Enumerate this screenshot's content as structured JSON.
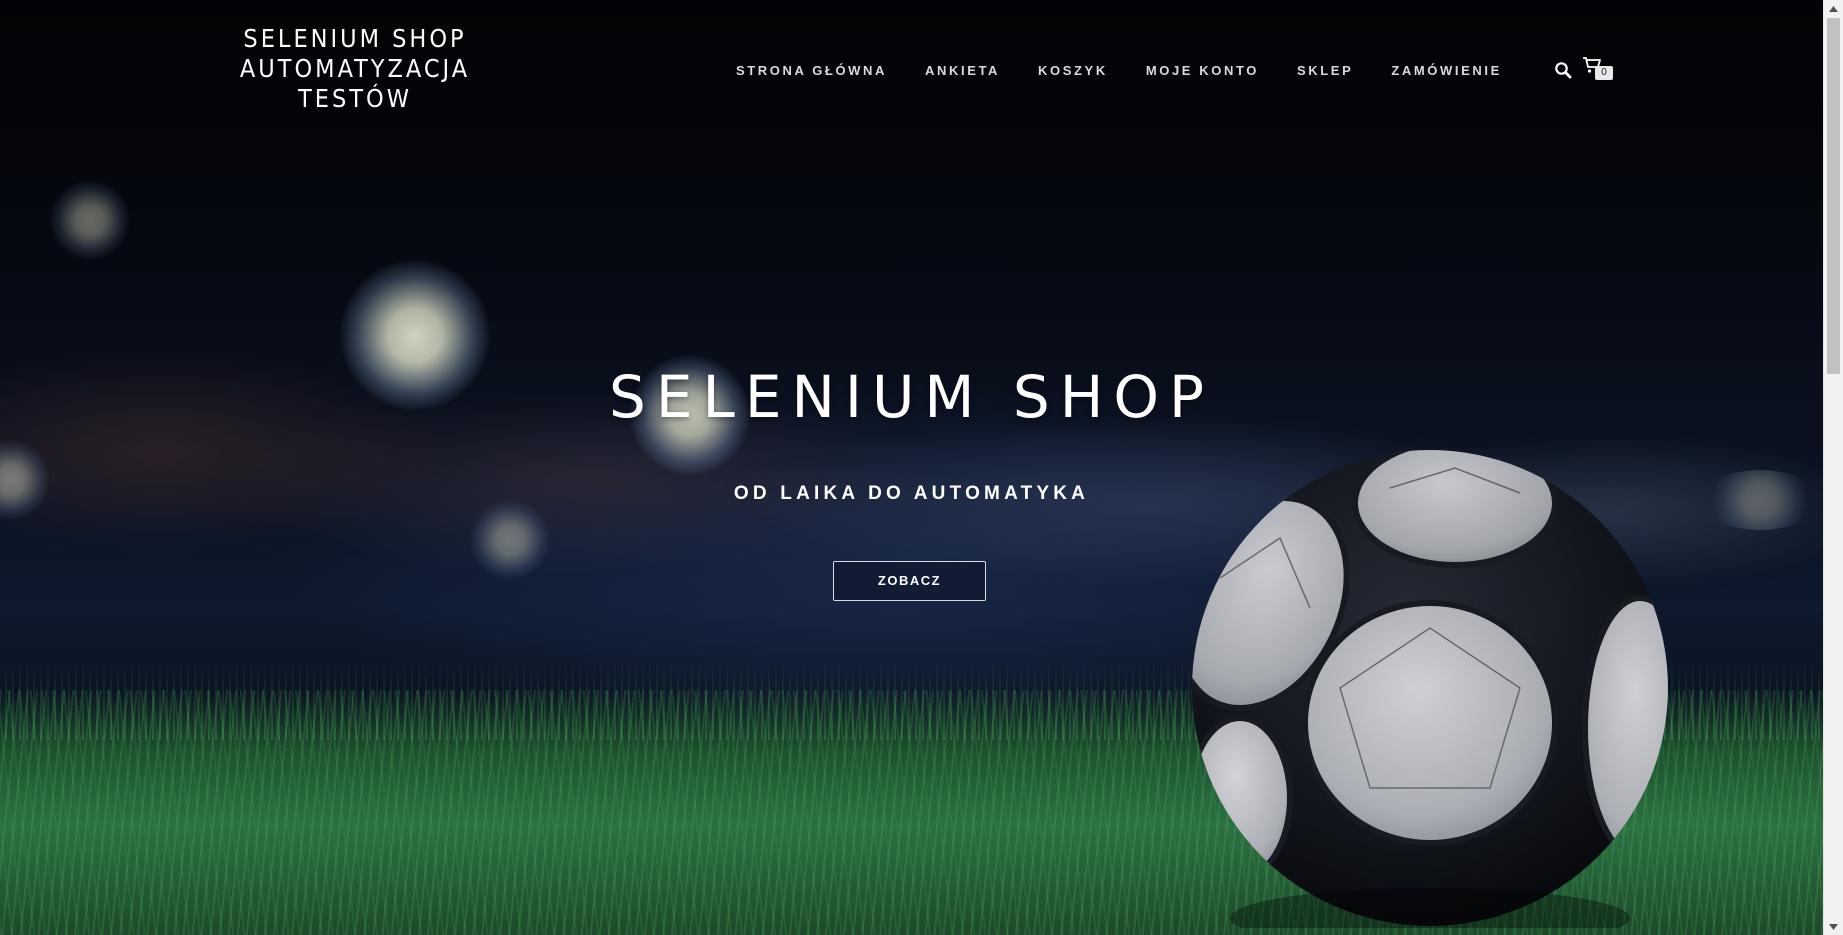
{
  "site": {
    "title_lines": [
      "SELENIUM SHOP",
      "AUTOMATYZACJA",
      "TESTÓW"
    ]
  },
  "nav": {
    "items": [
      {
        "label": "STRONA GŁÓWNA"
      },
      {
        "label": "ANKIETA"
      },
      {
        "label": "KOSZYK"
      },
      {
        "label": "MOJE KONTO"
      },
      {
        "label": "SKLEP"
      },
      {
        "label": "ZAMÓWIENIE"
      }
    ]
  },
  "header_icons": {
    "search_icon": "search-icon",
    "cart_icon": "shopping-cart-icon",
    "cart_count": "0"
  },
  "hero": {
    "title": "SELENIUM SHOP",
    "subtitle": "OD LAIKA DO AUTOMATYKA",
    "button_label": "ZOBACZ"
  },
  "colors": {
    "text": "#ffffff",
    "nav_text": "#d8dbe2",
    "grass": "#2e7a46",
    "sky": "#070b16"
  }
}
